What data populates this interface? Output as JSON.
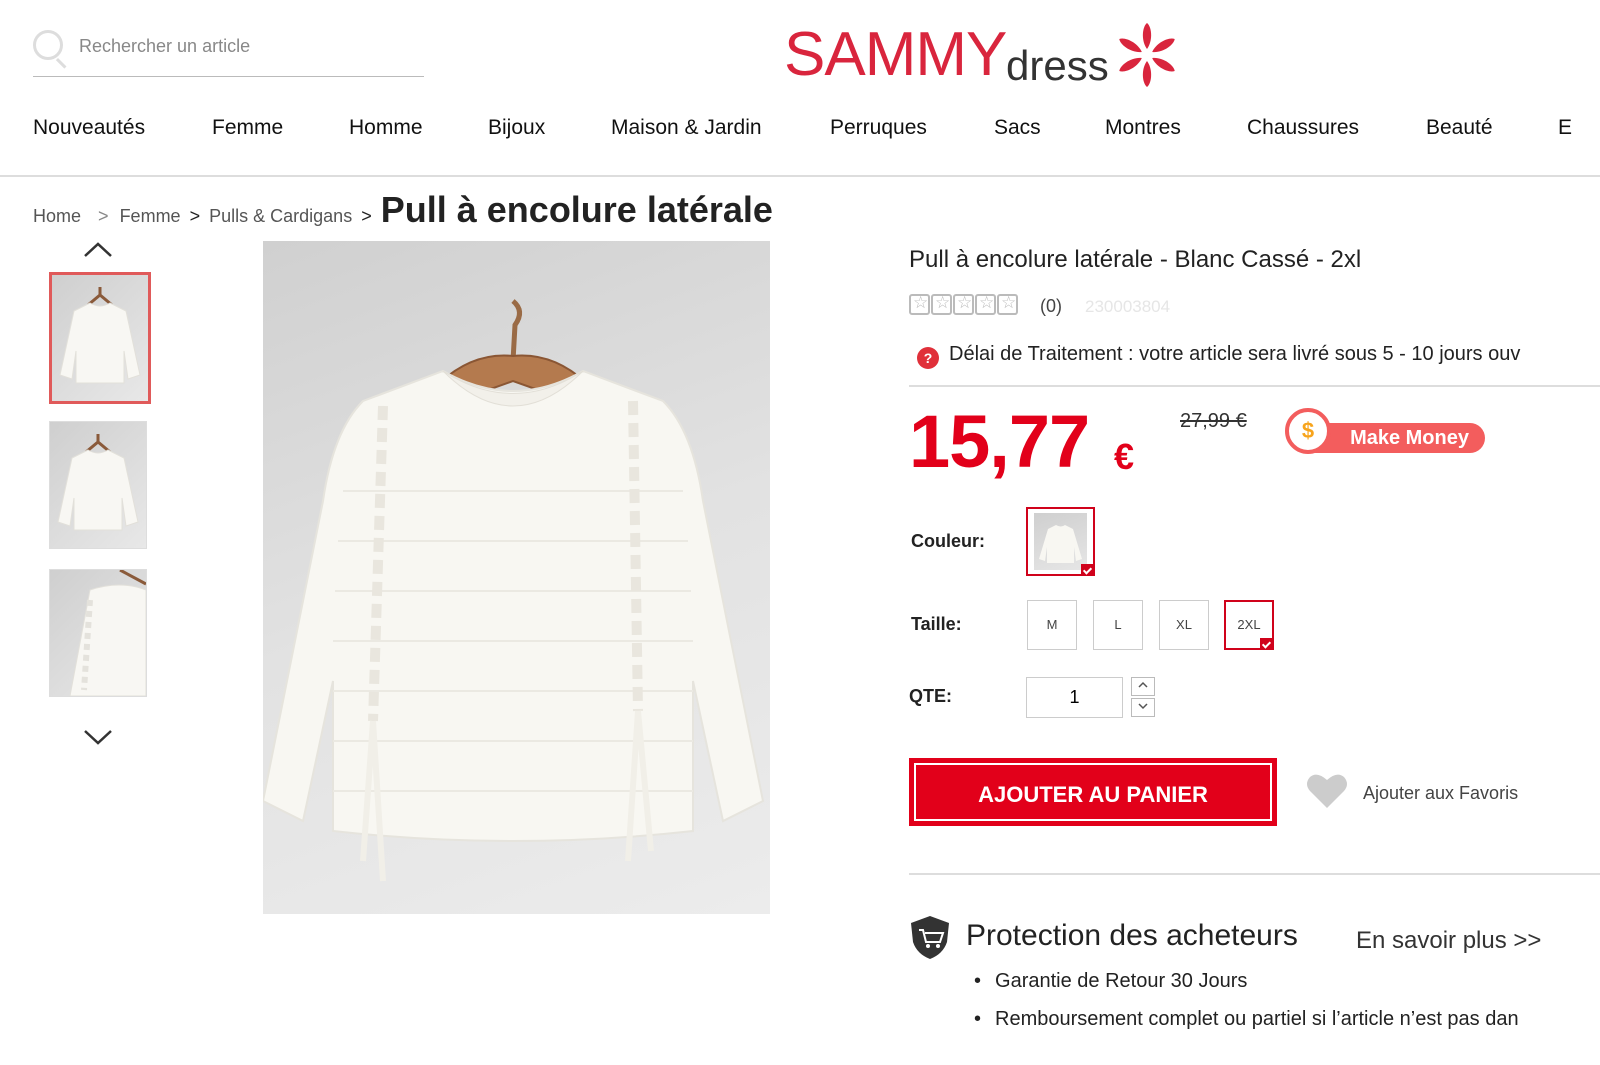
{
  "header": {
    "search_placeholder": "Rechercher un article",
    "logo_primary": "SAMMY",
    "logo_secondary": "dress"
  },
  "nav": {
    "items": [
      "Nouveautés",
      "Femme",
      "Homme",
      "Bijoux",
      "Maison & Jardin",
      "Perruques",
      "Sacs",
      "Montres",
      "Chaussures",
      "Beauté",
      "E"
    ]
  },
  "breadcrumb": {
    "home": "Home",
    "sep": ">",
    "level1": "Femme",
    "level2": "Pulls & Cardigans",
    "current": "Pull à encolure latérale"
  },
  "gallery": {
    "thumbnails": 3,
    "selected_index": 0
  },
  "product": {
    "title": "Pull à encolure latérale - Blanc Cassé - 2xl",
    "rating_stars": 0,
    "review_count": "(0)",
    "sku": "230003804",
    "delay_text": "Délai de Traitement : votre article sera livré sous 5 - 10 jours ouv",
    "price": "15,77",
    "currency": "€",
    "old_price": "27,99 €",
    "make_money_label": "Make Money",
    "color_label": "Couleur:",
    "size_label": "Taille:",
    "sizes": [
      "M",
      "L",
      "XL",
      "2XL"
    ],
    "selected_size": "2XL",
    "qty_label": "QTE:",
    "qty_value": "1",
    "add_to_cart": "AJOUTER AU PANIER",
    "add_to_favorites": "Ajouter aux Favoris"
  },
  "protection": {
    "title": "Protection des acheteurs",
    "learn_more": "En savoir plus >>",
    "bullets": [
      "Garantie de Retour 30 Jours",
      "Remboursement complet ou partiel si l’article n’est pas dan"
    ]
  },
  "colors": {
    "brand_red": "#e2001a",
    "logo_red": "#d9253d",
    "divider": "#dddddd"
  }
}
